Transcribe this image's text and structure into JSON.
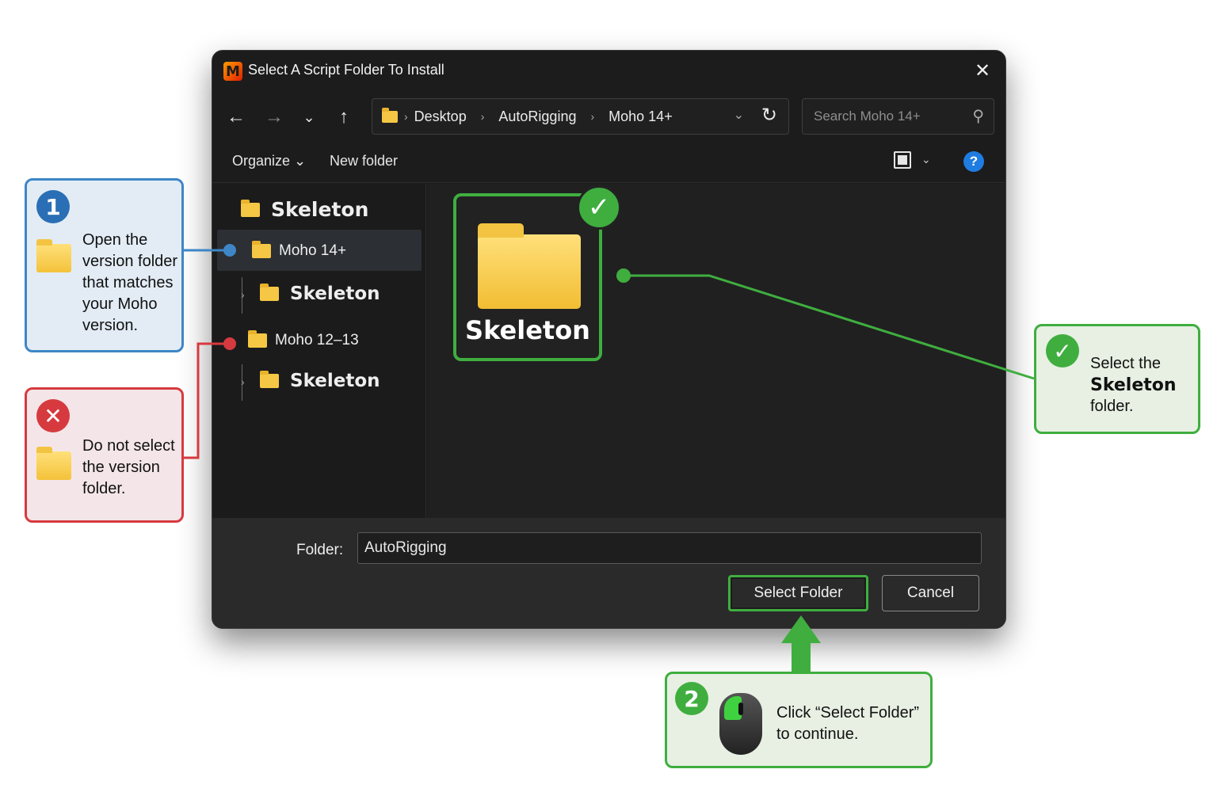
{
  "dialog": {
    "title": "Select A Script Folder To Install",
    "close_glyph": "✕",
    "nav": {
      "back": "←",
      "forward": "→",
      "recent": "⌄",
      "up": "↑"
    },
    "breadcrumbs": [
      "Desktop",
      "AutoRigging",
      "Moho 14+"
    ],
    "search_placeholder": "Search Moho 14+",
    "toolbar": {
      "organize": "Organize ⌄",
      "new_folder": "New folder"
    },
    "tree": [
      {
        "label": "Skeleton",
        "selected": false
      },
      {
        "label": "Moho 14+",
        "selected": true
      },
      {
        "label": "Skeleton",
        "selected": false
      },
      {
        "label": "Moho 12–13",
        "selected": false
      },
      {
        "label": "Skeleton",
        "selected": false
      }
    ],
    "content_item": "Skeleton",
    "folder_label": "Folder:",
    "folder_value": "AutoRigging",
    "select_button": "Select Folder",
    "cancel_button": "Cancel"
  },
  "callouts": {
    "step1": {
      "number": "1",
      "text_lines": [
        "Open the",
        "version folder",
        "that matches",
        "your Moho",
        "version."
      ]
    },
    "dont": {
      "text_lines": [
        "Do not select",
        "the version",
        "folder."
      ]
    },
    "select": {
      "line1": "Select the",
      "bold": "Skeleton",
      "line3": "folder."
    },
    "step2": {
      "number": "2",
      "text_lines": [
        "Click “Select Folder”",
        "to continue."
      ]
    }
  },
  "colors": {
    "green": "#3fae3f",
    "blue": "#3e86c6",
    "red": "#d63a3f",
    "folder": "#f5c744"
  }
}
